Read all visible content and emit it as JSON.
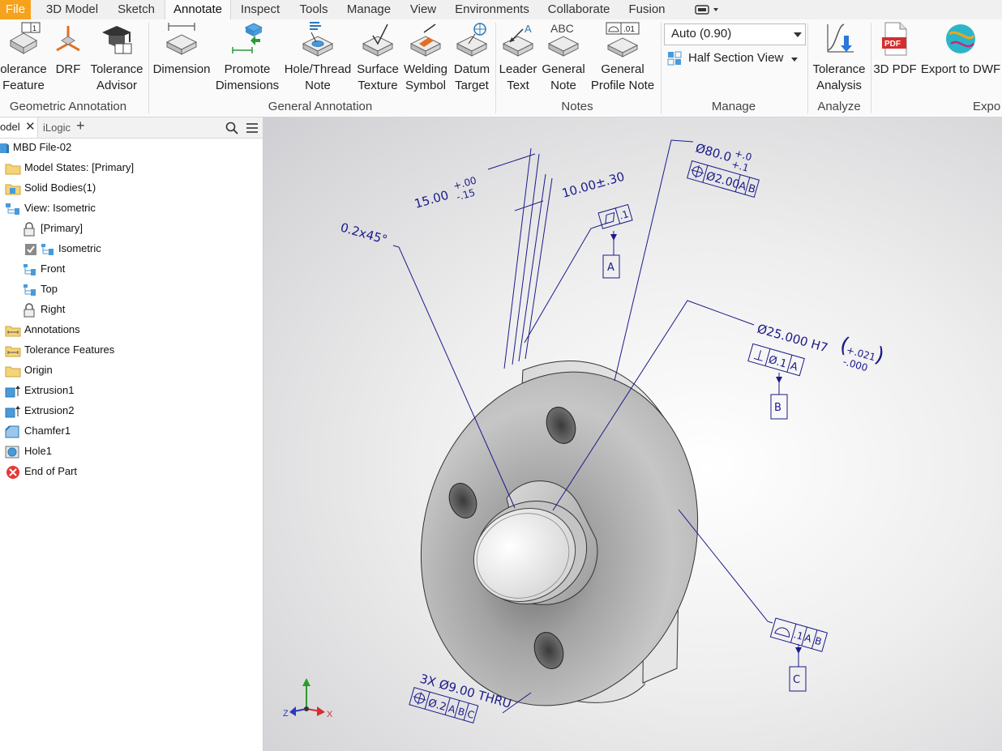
{
  "menu": {
    "tabs": [
      "File",
      "3D Model",
      "Sketch",
      "Annotate",
      "Inspect",
      "Tools",
      "Manage",
      "View",
      "Environments",
      "Collaborate",
      "Fusion"
    ],
    "active": "Annotate"
  },
  "ribbon": {
    "geometric": {
      "title": "Geometric Annotation",
      "tolerance_feature": [
        "olerance",
        "Feature"
      ],
      "drf": "DRF",
      "tolerance_advisor": [
        "Tolerance",
        "Advisor"
      ]
    },
    "general": {
      "title": "General Annotation",
      "dimension": "Dimension",
      "promote": [
        "Promote",
        "Dimensions"
      ],
      "hole_thread": [
        "Hole/Thread",
        "Note"
      ],
      "surface": [
        "Surface",
        "Texture"
      ],
      "welding": [
        "Welding",
        "Symbol"
      ],
      "datum": [
        "Datum",
        "Target"
      ]
    },
    "notes": {
      "title": "Notes",
      "leader": [
        "Leader",
        "Text"
      ],
      "general_note": [
        "General",
        "Note"
      ],
      "profile_note": [
        "General",
        "Profile Note"
      ]
    },
    "manage": {
      "title": "Manage",
      "scale_value": "Auto (0.90)",
      "section_view": "Half Section View"
    },
    "analyze": {
      "title": "Analyze",
      "tolerance_analysis": [
        "Tolerance",
        "Analysis"
      ]
    },
    "export": {
      "title": "Expo",
      "pdf": "3D PDF",
      "dwf": "Export to DWF",
      "pdf_badge": "PDF"
    }
  },
  "browser": {
    "tab_model": "odel",
    "tab_ilogic": "iLogic",
    "nodes": [
      "MBD File-02",
      "Model States: [Primary]",
      "Solid Bodies(1)",
      "View: Isometric",
      "[Primary]",
      "Isometric",
      "Front",
      "Top",
      "Right",
      "Annotations",
      "Tolerance Features",
      "Origin",
      "Extrusion1",
      "Extrusion2",
      "Chamfer1",
      "Hole1",
      "End of Part"
    ]
  },
  "viewport": {
    "annotations": {
      "dim15": "15.00",
      "dim15_tol_plus": "+.00",
      "dim15_tol_minus": "-.15",
      "dim10": "10.00±.30",
      "chamfer": "0.2x45°",
      "dia80": "Ø80.0",
      "dia80_tol_plus": "+.0",
      "dia80_tol_minus": "+.1",
      "fcf80_tol": "Ø2.00",
      "fcf80_d1": "A",
      "fcf80_d2": "B",
      "flat_tol": ".1",
      "datum_a": "A",
      "dia25": "Ø25.000 H7",
      "dia25_tol_plus": "+.021",
      "dia25_tol_minus": "-.000",
      "perp_tol": "Ø.1",
      "perp_datum": "A",
      "datum_b": "B",
      "profile_tol": ".1",
      "profile_d1": "A",
      "profile_d2": "B",
      "datum_c": "C",
      "hole_note": "3X Ø9.00 THRU",
      "hole_tol": "Ø.2",
      "hole_d1": "A",
      "hole_d2": "B",
      "hole_d3": "C"
    },
    "triad": {
      "x": "X",
      "z": "Z"
    }
  },
  "colors": {
    "annotation": "#1a1a8a",
    "file_tab": "#f6a21c",
    "part": "#8e8e8e"
  }
}
